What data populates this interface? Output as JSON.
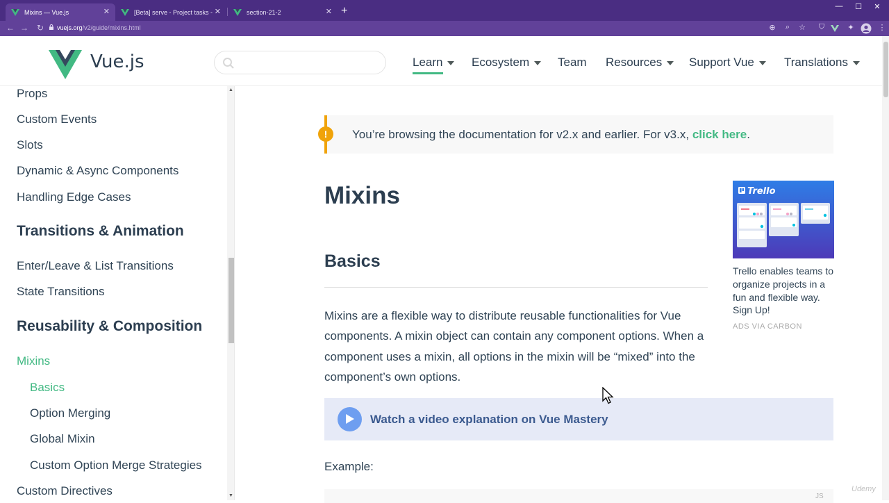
{
  "browser": {
    "tabs": [
      {
        "title": "Mixins — Vue.js",
        "active": true
      },
      {
        "title": "[Beta] serve - Project tasks - Vue",
        "active": false
      },
      {
        "title": "section-21-2",
        "active": false
      }
    ],
    "new_tab_symbol": "+",
    "window_controls": {
      "minimize": "—",
      "maximize": "☐",
      "close": "✕"
    },
    "url": {
      "host": "vuejs.org",
      "path": "/v2/guide/mixins.html"
    },
    "icons": [
      "back-icon",
      "forward-icon",
      "reload-icon",
      "lock-icon",
      "install-icon",
      "zoom-icon",
      "bookmark-star-icon",
      "extension-shield-icon",
      "vue-devtools-icon",
      "puzzle-extensions-icon",
      "profile-avatar-icon",
      "menu-dots-icon"
    ]
  },
  "header": {
    "brand": "Vue.js",
    "search_placeholder": "",
    "nav": [
      {
        "label": "Learn",
        "dropdown": true,
        "active": true
      },
      {
        "label": "Ecosystem",
        "dropdown": true
      },
      {
        "label": "Team",
        "dropdown": false
      },
      {
        "label": "Resources",
        "dropdown": true
      },
      {
        "label": "Support Vue",
        "dropdown": true
      },
      {
        "label": "Translations",
        "dropdown": true
      }
    ]
  },
  "sidebar": {
    "items": [
      {
        "label": "Props"
      },
      {
        "label": "Custom Events"
      },
      {
        "label": "Slots"
      },
      {
        "label": "Dynamic & Async Components"
      },
      {
        "label": "Handling Edge Cases"
      }
    ],
    "section_transitions": "Transitions & Animation",
    "transition_items": [
      {
        "label": "Enter/Leave & List Transitions"
      },
      {
        "label": "State Transitions"
      }
    ],
    "section_reusability": "Reusability & Composition",
    "current_page": "Mixins",
    "sub_items": [
      {
        "label": "Basics",
        "active": true
      },
      {
        "label": "Option Merging"
      },
      {
        "label": "Global Mixin"
      },
      {
        "label": "Custom Option Merge Strategies"
      }
    ],
    "next_item": "Custom Directives"
  },
  "main": {
    "tip": {
      "text": "You’re browsing the documentation for v2.x and earlier. For v3.x, ",
      "link": "click here",
      "suffix": "."
    },
    "title": "Mixins",
    "section_heading": "Basics",
    "paragraph": "Mixins are a flexible way to distribute reusable functionalities for Vue components. A mixin object can contain any component options. When a component uses a mixin, all options in the mixin will be “mixed” into the component’s own options.",
    "video_label": "Watch a video explanation on Vue Mastery",
    "example_label": "Example:",
    "code_lang": "JS"
  },
  "ad": {
    "image_brand": "Trello",
    "text": "Trello enables teams to organize projects in a fun and flexible way. Sign Up!",
    "via": "ADS VIA CARBON"
  },
  "watermark": "Udemy",
  "colors": {
    "chrome_tabbar": "#4a2d82",
    "chrome_toolbar": "#614199",
    "vue_green": "#42b983",
    "text_dark": "#2c3e50",
    "tip_orange": "#f0a30a",
    "video_box": "#e6eaf7"
  }
}
